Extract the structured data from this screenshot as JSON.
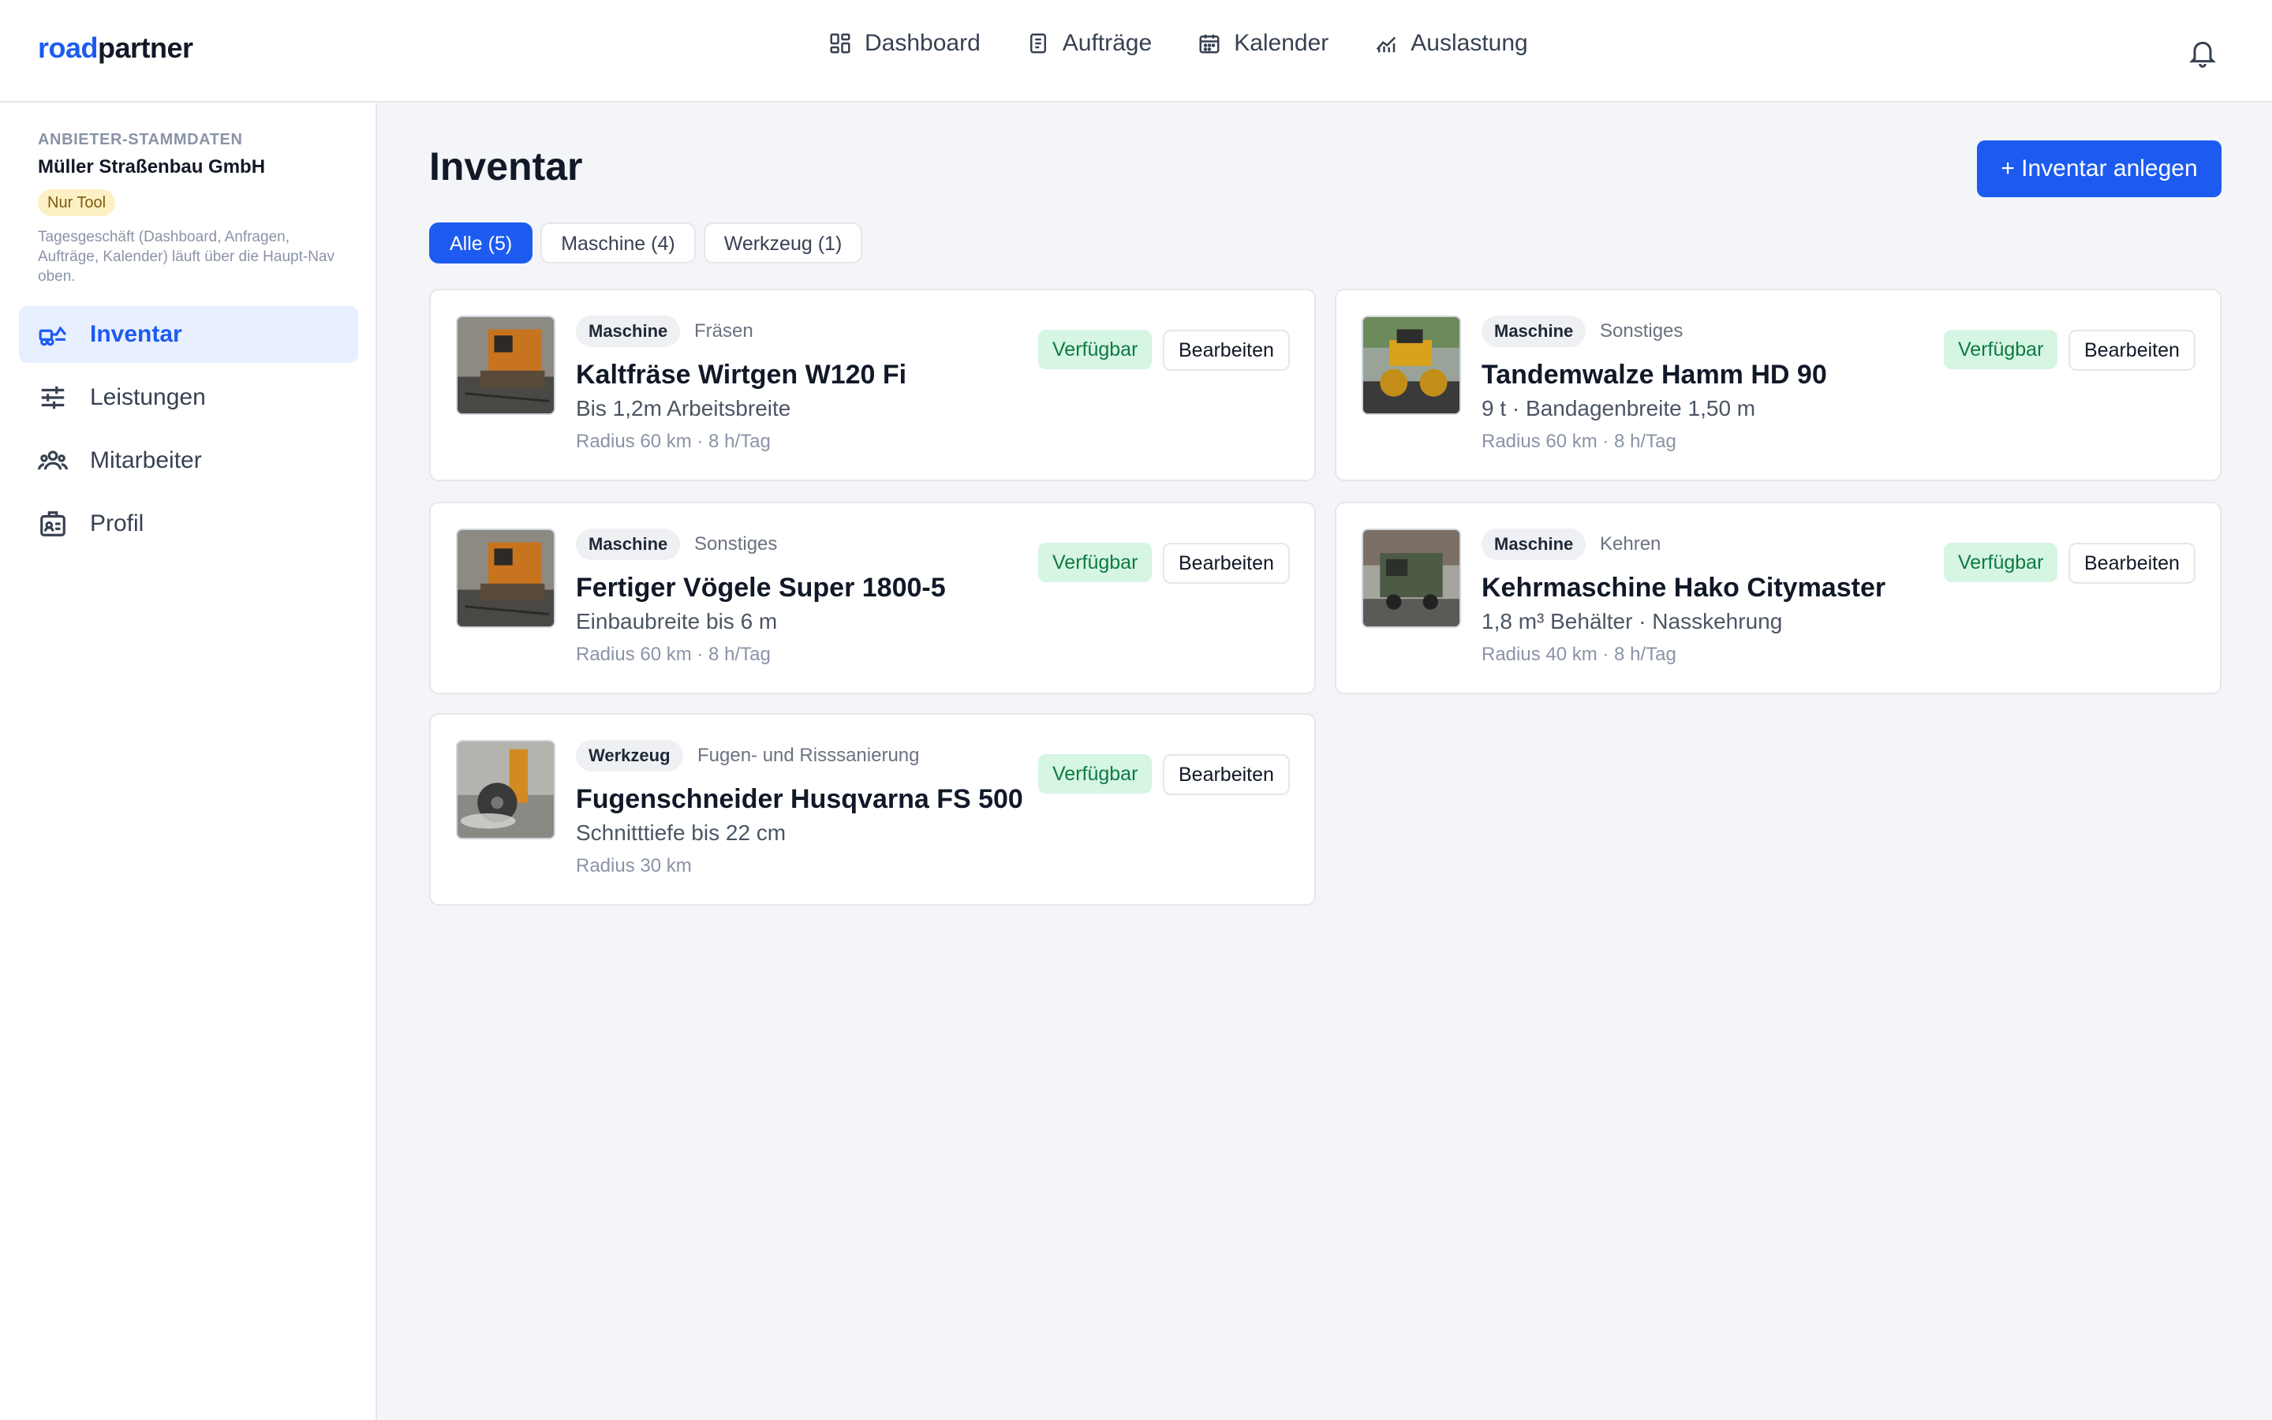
{
  "brand": {
    "part1": "road",
    "part2": "partner"
  },
  "nav": {
    "items": [
      {
        "label": "Dashboard",
        "icon": "dashboard-icon"
      },
      {
        "label": "Aufträge",
        "icon": "clipboard-icon"
      },
      {
        "label": "Kalender",
        "icon": "calendar-icon"
      },
      {
        "label": "Auslastung",
        "icon": "chart-icon"
      }
    ],
    "notifications_icon": "bell-icon"
  },
  "sidebar": {
    "caption": "ANBIETER-STAMMDATEN",
    "company": "Müller Straßenbau GmbH",
    "badge": "Nur Tool",
    "note": "Tagesgeschäft (Dashboard, Anfragen, Aufträge, Kalender) läuft über die Haupt-Nav oben.",
    "items": [
      {
        "label": "Inventar",
        "icon": "machinery-icon",
        "active": true
      },
      {
        "label": "Leistungen",
        "icon": "sliders-icon",
        "active": false
      },
      {
        "label": "Mitarbeiter",
        "icon": "team-icon",
        "active": false
      },
      {
        "label": "Profil",
        "icon": "id-card-icon",
        "active": false
      }
    ]
  },
  "main": {
    "title": "Inventar",
    "add_button": "+ Inventar anlegen",
    "filters": [
      {
        "label": "Alle (5)",
        "active": true
      },
      {
        "label": "Maschine (4)",
        "active": false
      },
      {
        "label": "Werkzeug (1)",
        "active": false
      }
    ],
    "cards": [
      {
        "type": "Maschine",
        "category": "Fräsen",
        "title": "Kaltfräse Wirtgen W120 Fi",
        "subtitle": "Bis 1,2m Arbeitsbreite",
        "meta": "Radius 60 km · 8 h/Tag",
        "status": "Verfügbar",
        "action": "Bearbeiten",
        "image": "milling-machine"
      },
      {
        "type": "Maschine",
        "category": "Sonstiges",
        "title": "Tandemwalze Hamm HD 90",
        "subtitle": "9 t · Bandagenbreite 1,50 m",
        "meta": "Radius 60 km · 8 h/Tag",
        "status": "Verfügbar",
        "action": "Bearbeiten",
        "image": "road-roller"
      },
      {
        "type": "Maschine",
        "category": "Sonstiges",
        "title": "Fertiger Vögele Super 1800-5",
        "subtitle": "Einbaubreite bis 6 m",
        "meta": "Radius 60 km · 8 h/Tag",
        "status": "Verfügbar",
        "action": "Bearbeiten",
        "image": "paver"
      },
      {
        "type": "Maschine",
        "category": "Kehren",
        "title": "Kehrmaschine Hako Citymaster",
        "subtitle": "1,8 m³ Behälter · Nasskehrung",
        "meta": "Radius 40 km · 8 h/Tag",
        "status": "Verfügbar",
        "action": "Bearbeiten",
        "image": "street-sweeper"
      },
      {
        "type": "Werkzeug",
        "category": "Fugen- und Risssanierung",
        "title": "Fugenschneider Husqvarna FS 500",
        "subtitle": "Schnitttiefe bis 22 cm",
        "meta": "Radius 30 km",
        "status": "Verfügbar",
        "action": "Bearbeiten",
        "image": "joint-cutter"
      }
    ]
  },
  "colors": {
    "accent": "#1d5bf0",
    "status_bg": "#d6f5e3",
    "status_text": "#0f7a43",
    "badge_bg": "#fdf0c4"
  }
}
